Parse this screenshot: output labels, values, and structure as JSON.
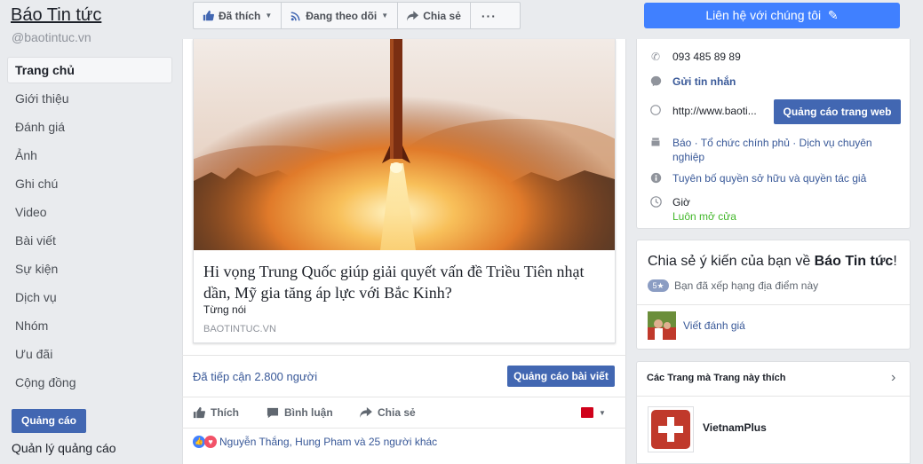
{
  "page": {
    "name": "Báo Tin tức",
    "handle": "@baotintuc.vn"
  },
  "nav": [
    {
      "label": "Trang chủ",
      "active": true
    },
    {
      "label": "Giới thiệu"
    },
    {
      "label": "Đánh giá"
    },
    {
      "label": "Ảnh"
    },
    {
      "label": "Ghi chú"
    },
    {
      "label": "Video"
    },
    {
      "label": "Bài viết"
    },
    {
      "label": "Sự kiện"
    },
    {
      "label": "Dịch vụ"
    },
    {
      "label": "Nhóm"
    },
    {
      "label": "Ưu đãi"
    },
    {
      "label": "Cộng đồng"
    }
  ],
  "ads_button": "Quảng cáo",
  "ads_manager": "Quản lý quảng cáo",
  "topbar": {
    "liked": "Đã thích",
    "following": "Đang theo dõi",
    "share": "Chia sẻ",
    "more": "···"
  },
  "contact_button": "Liên hệ với chúng tôi",
  "post": {
    "headline": "Hi vọng Trung Quốc giúp giải quyết vấn đề Triều Tiên nhạt dần, Mỹ gia tăng áp lực với Bắc Kinh?",
    "subtitle": "Từng nói",
    "domain": "BAOTINTUC.VN",
    "reach": "Đã tiếp cận 2.800 người",
    "boost": "Quảng cáo bài viết",
    "actions": {
      "like": "Thích",
      "comment": "Bình luận",
      "share": "Chia sẻ"
    },
    "reactions": "Nguyễn Thắng, Hung Pham và 25 người khác"
  },
  "about": {
    "phone": "093 485 89 89",
    "message": "Gửi tin nhắn",
    "website": "http://www.baoti...",
    "website_ad": "Quảng cáo trang web",
    "category": "Báo · Tổ chức chính phủ · Dịch vụ chuyên nghiệp",
    "copyright": "Tuyên bố quyền sở hữu và quyền tác giả",
    "hours_label": "Giờ",
    "hours_value": "Luôn mở cửa"
  },
  "review": {
    "prompt_prefix": "Chia sẻ ý kiến của bạn về ",
    "prompt_name": "Báo Tin tức",
    "prompt_suffix": "!",
    "badge": "5★",
    "rated": "Bạn đã xếp hạng địa điểm này",
    "write": "Viết đánh giá"
  },
  "liked_pages": {
    "title": "Các Trang mà Trang này thích",
    "items": [
      {
        "name": "VietnamPlus"
      }
    ]
  },
  "colors": {
    "brand": "#4267b2",
    "accent": "#4080ff",
    "link": "#385898",
    "open": "#42b72a"
  }
}
